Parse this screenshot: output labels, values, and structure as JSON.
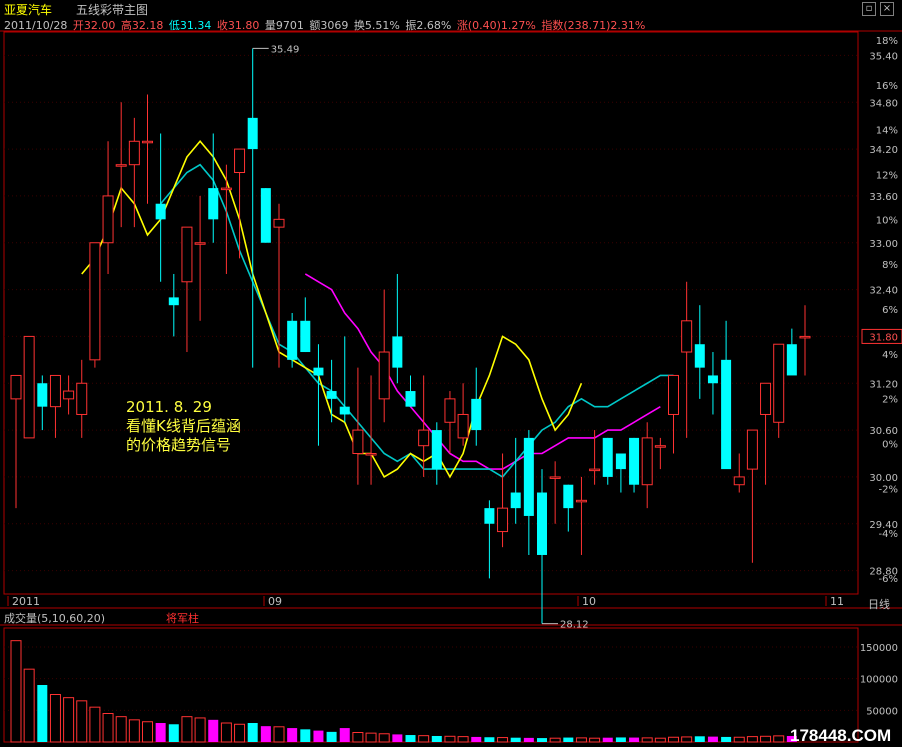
{
  "app": {
    "stock_name": "亚夏汽车",
    "indicator_name": "五线彩带主图"
  },
  "window_buttons": {
    "restore": "▫",
    "close": "×"
  },
  "info_bar": {
    "date": "2011/10/28",
    "open": "开32.00",
    "high": "高32.18",
    "low": "低31.34",
    "close": "收31.80",
    "volume": "量9701",
    "amount": "额3069",
    "turnover": "换5.51%",
    "amplitude": "振2.68%",
    "change": "涨(0.40)1.27%",
    "index": "指数(238.71)2.31%"
  },
  "price_axis": {
    "labels": [
      "35.40",
      "34.80",
      "34.20",
      "33.60",
      "33.00",
      "32.40",
      "31.80",
      "31.20",
      "30.60",
      "30.00",
      "29.40",
      "28.80"
    ],
    "percents": [
      "18%",
      "16%",
      "14%",
      "12%",
      "10%",
      "8%",
      "6%",
      "4%",
      "2%",
      "0%",
      "-2%",
      "-4%",
      "-6%"
    ],
    "current": "31.80"
  },
  "time_axis": {
    "labels": [
      "2011",
      "09",
      "10",
      "11"
    ],
    "period": "日线"
  },
  "markers": {
    "high": "35.49",
    "low": "28.12"
  },
  "annotation": {
    "line1": "2011. 8. 29",
    "line2": "看懂K线背后蕴涵",
    "line3": "的价格趋势信号"
  },
  "volume_panel": {
    "title": "成交量(5,10,60,20)",
    "tag": "将军柱",
    "labels": [
      "150000",
      "100000",
      "50000"
    ]
  },
  "colors": {
    "up": "#ff3232",
    "down": "#00ffff",
    "ma_yellow": "#ffff00",
    "ma_cyan": "#00c8c8",
    "ma_magenta": "#ff00ff",
    "vol_magenta": "#ff00ff"
  },
  "watermark": "178448.COM",
  "chart_data": {
    "type": "candlestick",
    "ylim": [
      28.5,
      35.7
    ],
    "candles": [
      {
        "o": 31.0,
        "h": 31.3,
        "l": 29.6,
        "c": 31.3
      },
      {
        "o": 30.5,
        "h": 31.8,
        "l": 30.5,
        "c": 31.8
      },
      {
        "o": 31.2,
        "h": 31.3,
        "l": 30.6,
        "c": 30.9
      },
      {
        "o": 30.9,
        "h": 31.3,
        "l": 30.5,
        "c": 31.3
      },
      {
        "o": 31.0,
        "h": 31.3,
        "l": 30.8,
        "c": 31.1
      },
      {
        "o": 30.8,
        "h": 31.5,
        "l": 30.5,
        "c": 31.2
      },
      {
        "o": 31.5,
        "h": 33.0,
        "l": 31.4,
        "c": 33.0
      },
      {
        "o": 33.0,
        "h": 34.3,
        "l": 32.6,
        "c": 33.6
      },
      {
        "o": 34.0,
        "h": 34.8,
        "l": 33.2,
        "c": 34.0
      },
      {
        "o": 34.0,
        "h": 34.6,
        "l": 33.2,
        "c": 34.3
      },
      {
        "o": 34.3,
        "h": 34.9,
        "l": 33.5,
        "c": 34.3
      },
      {
        "o": 33.5,
        "h": 34.4,
        "l": 32.5,
        "c": 33.3
      },
      {
        "o": 32.3,
        "h": 32.6,
        "l": 31.8,
        "c": 32.2
      },
      {
        "o": 32.5,
        "h": 33.2,
        "l": 31.6,
        "c": 33.2
      },
      {
        "o": 33.0,
        "h": 33.6,
        "l": 32.0,
        "c": 33.0
      },
      {
        "o": 33.7,
        "h": 34.4,
        "l": 33.0,
        "c": 33.3
      },
      {
        "o": 33.7,
        "h": 34.0,
        "l": 32.6,
        "c": 33.7
      },
      {
        "o": 33.9,
        "h": 34.2,
        "l": 32.8,
        "c": 34.2
      },
      {
        "o": 34.6,
        "h": 35.49,
        "l": 31.4,
        "c": 34.2
      },
      {
        "o": 33.7,
        "h": 33.7,
        "l": 33.0,
        "c": 33.0
      },
      {
        "o": 33.2,
        "h": 33.5,
        "l": 31.4,
        "c": 33.3
      },
      {
        "o": 32.0,
        "h": 32.1,
        "l": 31.4,
        "c": 31.5
      },
      {
        "o": 32.0,
        "h": 32.3,
        "l": 31.6,
        "c": 31.6
      },
      {
        "o": 31.4,
        "h": 31.7,
        "l": 30.4,
        "c": 31.3
      },
      {
        "o": 31.1,
        "h": 31.5,
        "l": 30.7,
        "c": 31.0
      },
      {
        "o": 30.9,
        "h": 31.8,
        "l": 30.7,
        "c": 30.8
      },
      {
        "o": 30.3,
        "h": 31.4,
        "l": 29.9,
        "c": 30.6
      },
      {
        "o": 30.3,
        "h": 31.3,
        "l": 29.9,
        "c": 30.3
      },
      {
        "o": 31.0,
        "h": 32.4,
        "l": 30.7,
        "c": 31.6
      },
      {
        "o": 31.8,
        "h": 32.6,
        "l": 31.2,
        "c": 31.4
      },
      {
        "o": 31.1,
        "h": 31.3,
        "l": 30.9,
        "c": 30.9
      },
      {
        "o": 30.4,
        "h": 31.3,
        "l": 30.0,
        "c": 30.6
      },
      {
        "o": 30.6,
        "h": 30.7,
        "l": 29.9,
        "c": 30.1
      },
      {
        "o": 30.7,
        "h": 31.1,
        "l": 30.3,
        "c": 31.0
      },
      {
        "o": 30.5,
        "h": 31.2,
        "l": 30.4,
        "c": 30.8
      },
      {
        "o": 31.0,
        "h": 31.4,
        "l": 30.4,
        "c": 30.6
      },
      {
        "o": 29.6,
        "h": 29.7,
        "l": 28.7,
        "c": 29.4
      },
      {
        "o": 29.3,
        "h": 30.3,
        "l": 29.1,
        "c": 29.6
      },
      {
        "o": 29.8,
        "h": 30.5,
        "l": 29.4,
        "c": 29.6
      },
      {
        "o": 30.5,
        "h": 30.6,
        "l": 29.0,
        "c": 29.5
      },
      {
        "o": 29.8,
        "h": 30.1,
        "l": 28.12,
        "c": 29.0
      },
      {
        "o": 30.0,
        "h": 30.2,
        "l": 29.4,
        "c": 30.0
      },
      {
        "o": 29.9,
        "h": 29.9,
        "l": 29.3,
        "c": 29.6
      },
      {
        "o": 29.7,
        "h": 30.0,
        "l": 29.0,
        "c": 29.7
      },
      {
        "o": 30.1,
        "h": 30.6,
        "l": 29.9,
        "c": 30.1
      },
      {
        "o": 30.5,
        "h": 30.5,
        "l": 29.9,
        "c": 30.0
      },
      {
        "o": 30.3,
        "h": 30.3,
        "l": 29.8,
        "c": 30.1
      },
      {
        "o": 30.5,
        "h": 30.5,
        "l": 29.8,
        "c": 29.9
      },
      {
        "o": 29.9,
        "h": 30.7,
        "l": 29.6,
        "c": 30.5
      },
      {
        "o": 30.4,
        "h": 30.5,
        "l": 30.1,
        "c": 30.4
      },
      {
        "o": 30.8,
        "h": 31.2,
        "l": 30.3,
        "c": 31.3
      },
      {
        "o": 31.6,
        "h": 32.5,
        "l": 30.5,
        "c": 32.0
      },
      {
        "o": 31.7,
        "h": 32.2,
        "l": 31.0,
        "c": 31.4
      },
      {
        "o": 31.3,
        "h": 31.6,
        "l": 30.8,
        "c": 31.2
      },
      {
        "o": 31.5,
        "h": 32.0,
        "l": 31.0,
        "c": 30.1
      },
      {
        "o": 29.9,
        "h": 30.3,
        "l": 29.8,
        "c": 30.0
      },
      {
        "o": 30.1,
        "h": 30.4,
        "l": 28.9,
        "c": 30.6
      },
      {
        "o": 30.8,
        "h": 31.0,
        "l": 29.9,
        "c": 31.2
      },
      {
        "o": 30.7,
        "h": 31.5,
        "l": 30.5,
        "c": 31.7
      },
      {
        "o": 31.7,
        "h": 31.9,
        "l": 31.6,
        "c": 31.3
      },
      {
        "o": 31.8,
        "h": 32.2,
        "l": 31.3,
        "c": 31.8
      }
    ],
    "ma_yellow": [
      32.6,
      32.8,
      33.2,
      33.7,
      33.5,
      33.1,
      33.3,
      33.7,
      34.1,
      34.3,
      34.1,
      33.8,
      33.3,
      32.6,
      32.1,
      31.6,
      31.5,
      31.4,
      31.3,
      30.8,
      30.7,
      30.3,
      30.3,
      30.0,
      30.1,
      30.3,
      30.2,
      30.3,
      30.0,
      30.3,
      30.9,
      31.3,
      31.8,
      31.7,
      31.5,
      31.0,
      30.6,
      30.8,
      31.2
    ],
    "ma_cyan": [
      33.5,
      33.7,
      33.9,
      34.0,
      33.8,
      33.4,
      32.9,
      32.5,
      32.1,
      31.7,
      31.6,
      31.4,
      31.2,
      31.1,
      30.9,
      30.7,
      30.5,
      30.3,
      30.2,
      30.3,
      30.1,
      30.1,
      30.1,
      30.1,
      30.1,
      30.1,
      30.0,
      30.2,
      30.4,
      30.6,
      30.7,
      30.9,
      31.0,
      30.9,
      30.9,
      31.0,
      31.1,
      31.2,
      31.3,
      31.3
    ],
    "ma_magenta": [
      32.6,
      32.5,
      32.4,
      32.1,
      31.9,
      31.6,
      31.4,
      31.1,
      30.9,
      30.7,
      30.5,
      30.3,
      30.2,
      30.2,
      30.1,
      30.1,
      30.2,
      30.3,
      30.3,
      30.4,
      30.5,
      30.5,
      30.5,
      30.6,
      30.6,
      30.7,
      30.8,
      30.9
    ],
    "volume": [
      160000,
      115000,
      90000,
      75000,
      70000,
      65000,
      55000,
      45000,
      40000,
      35000,
      32000,
      30000,
      28000,
      40000,
      38000,
      35000,
      30000,
      28000,
      30000,
      25000,
      24000,
      22000,
      20000,
      18000,
      16000,
      22000,
      15000,
      14000,
      13000,
      12000,
      11000,
      10000,
      9500,
      9000,
      8500,
      8000,
      7500,
      7000,
      6800,
      6500,
      6200,
      6000,
      7000,
      6500,
      6000,
      6800,
      7200,
      7000,
      6500,
      6000,
      7500,
      8000,
      9000,
      8500,
      8000,
      7500,
      8500,
      9000,
      9701,
      9500
    ]
  }
}
